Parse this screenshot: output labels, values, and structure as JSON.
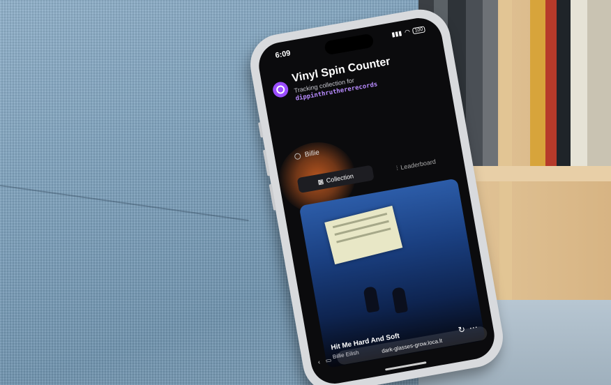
{
  "status_bar": {
    "time": "6:09",
    "battery": "100"
  },
  "app": {
    "title": "Vinyl Spin Counter",
    "subtitle": "Tracking collection for",
    "username": "dippinthruthererecords"
  },
  "profile": {
    "name": "Billie"
  },
  "tabs": [
    {
      "label": "Collection",
      "active": true
    },
    {
      "label": "Leaderboard",
      "active": false
    }
  ],
  "record": {
    "title": "Hit Me Hard And Soft",
    "artist": "Billie Eilish"
  },
  "browser": {
    "url": "dark-glasses-grow.loca.lt"
  }
}
